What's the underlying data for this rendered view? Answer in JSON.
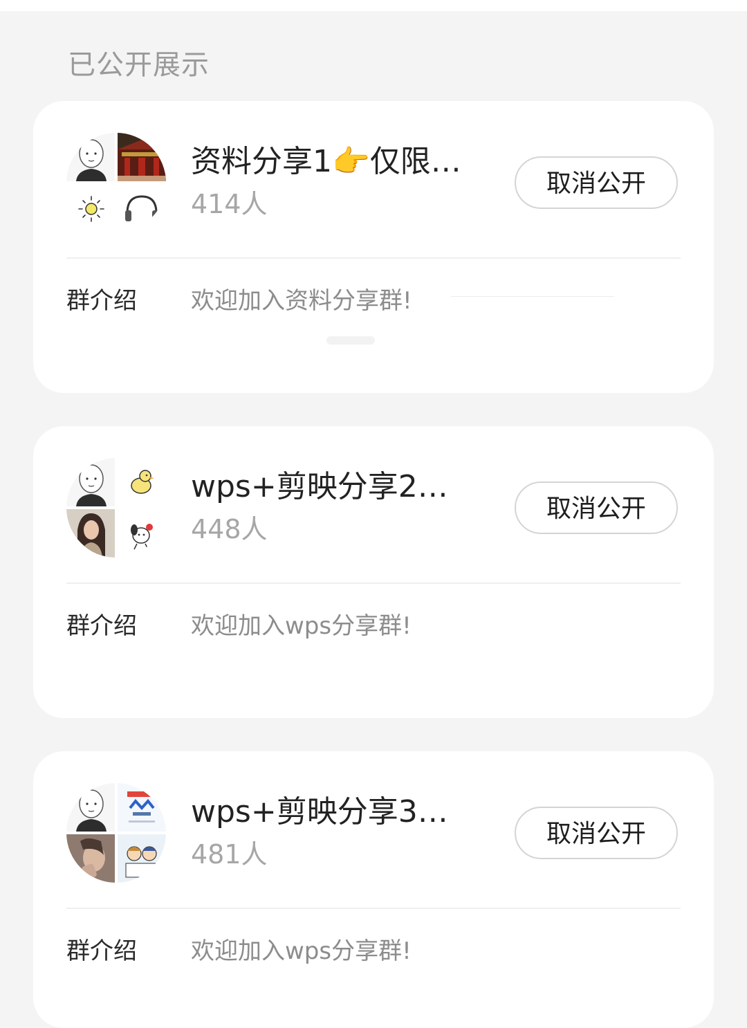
{
  "section": {
    "title": "已公开展示"
  },
  "groups": [
    {
      "name": "资料分享1👉仅限…",
      "members": "414人",
      "button_label": "取消公开",
      "intro_label": "群介绍",
      "intro": "欢迎加入资料分享群!"
    },
    {
      "name": "wps+剪映分享2…",
      "members": "448人",
      "button_label": "取消公开",
      "intro_label": "群介绍",
      "intro": "欢迎加入wps分享群!"
    },
    {
      "name": "wps+剪映分享3…",
      "members": "481人",
      "button_label": "取消公开",
      "intro_label": "群介绍",
      "intro": "欢迎加入wps分享群!"
    }
  ],
  "colors": {
    "background": "#f4f4f4",
    "card": "#ffffff",
    "title_gray": "#9a9a9a",
    "count_gray": "#a6a6a6",
    "button_border": "#d4d4d4"
  },
  "icons": {
    "member_avatar": "cartoon-face-icon",
    "sun": "sun-icon",
    "headphones": "headphones-icon",
    "duck": "duck-icon",
    "puppy": "puppy-icon"
  }
}
